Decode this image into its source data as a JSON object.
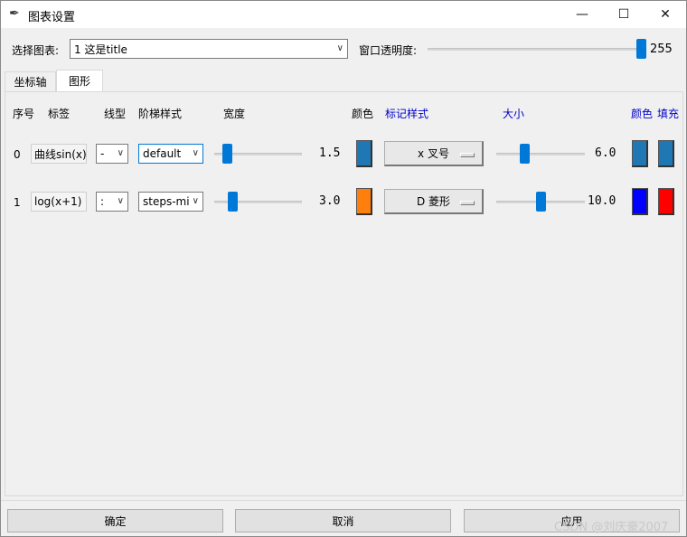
{
  "window": {
    "title": "图表设置"
  },
  "top": {
    "chart_label": "选择图表:",
    "chart_value": "1  这是title",
    "opacity_label": "窗口透明度:",
    "opacity_value": "255",
    "opacity_fraction": 1.0
  },
  "tabs": [
    {
      "label": "坐标轴"
    },
    {
      "label": "图形"
    }
  ],
  "headers": {
    "index": "序号",
    "label": "标签",
    "linestyle": "线型",
    "drawstyle": "阶梯样式",
    "width": "宽度",
    "color": "颜色",
    "marker": "标记样式",
    "size": "大小",
    "marker_color": "颜色",
    "marker_fill": "填充"
  },
  "rows": [
    {
      "index": "0",
      "label": "曲线sin(x)",
      "linestyle": "-",
      "drawstyle": "default",
      "width": "1.5",
      "width_fraction": 0.1,
      "color": "#1f77b4",
      "marker": "x 叉号",
      "size": "6.0",
      "size_fraction": 0.3,
      "marker_color": "#1f77b4",
      "marker_fill": "#1f77b4"
    },
    {
      "index": "1",
      "label": "log(x+1)",
      "linestyle": ":",
      "drawstyle": "steps-mi",
      "width": "3.0",
      "width_fraction": 0.17,
      "color": "#ff7f0e",
      "marker": "D 菱形",
      "size": "10.0",
      "size_fraction": 0.5,
      "marker_color": "#0000ff",
      "marker_fill": "#ff0000"
    }
  ],
  "footer": {
    "ok": "确定",
    "cancel": "取消",
    "apply": "应用"
  },
  "watermark": "CSDN @刘庆豪2007"
}
